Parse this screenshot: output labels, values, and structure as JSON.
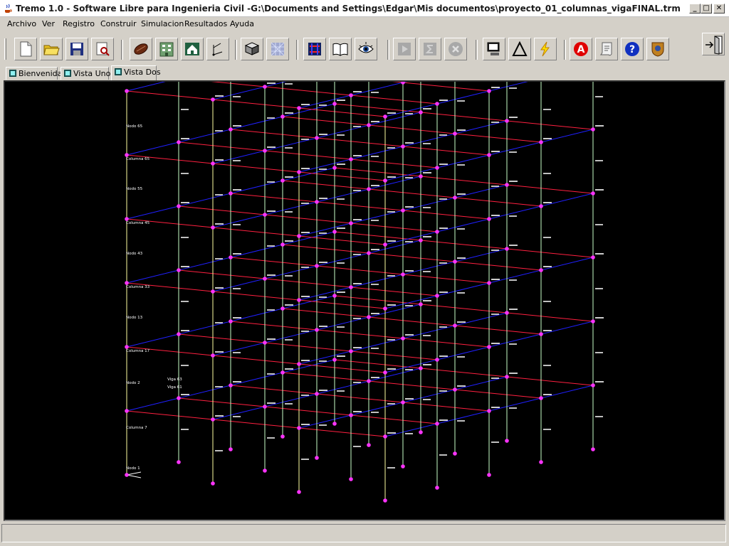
{
  "window": {
    "title": "Tremo 1.0 - Software Libre para Ingenieria Civil -G:\\Documents and Settings\\Edgar\\Mis documentos\\proyecto_01_columnas_vigaFINAL.trm",
    "controls": {
      "minimize": "_",
      "maximize": "□",
      "close": "✕"
    }
  },
  "menu": {
    "items": [
      "Archivo",
      "Ver",
      "Registro",
      "Construir",
      "Simulacion",
      "Resultados",
      "Ayuda"
    ]
  },
  "toolbar": {
    "buttons": [
      {
        "name": "new-file-icon"
      },
      {
        "name": "open-folder-icon"
      },
      {
        "name": "save-icon"
      },
      {
        "name": "print-preview-icon"
      },
      {
        "name": "material-icon"
      },
      {
        "name": "building-icon"
      },
      {
        "name": "house-icon"
      },
      {
        "name": "node-axes-icon"
      },
      {
        "name": "section-icon"
      },
      {
        "name": "mesh-icon"
      },
      {
        "name": "frame-color-icon"
      },
      {
        "name": "book-icon"
      },
      {
        "name": "eye-icon"
      },
      {
        "name": "play-icon"
      },
      {
        "name": "sigma-icon"
      },
      {
        "name": "stop-icon"
      },
      {
        "name": "monitor-icon"
      },
      {
        "name": "delta-icon"
      },
      {
        "name": "lightning-icon"
      },
      {
        "name": "acrobat-icon"
      },
      {
        "name": "script-icon"
      },
      {
        "name": "help-icon"
      },
      {
        "name": "badge-icon"
      }
    ],
    "exit": {
      "name": "exit-door-icon"
    }
  },
  "tabs": [
    {
      "label": "Bienvenida",
      "active": false
    },
    {
      "label": "Vista Uno",
      "active": false
    },
    {
      "label": "Vista Dos",
      "active": true
    }
  ],
  "viewport": {
    "background": "#000000",
    "colors": {
      "node": "#ff33ff",
      "column": "#c8ffc8",
      "column_front": "#ffffa0",
      "beam_x": "#ff2040",
      "beam_y": "#2020ff",
      "label": "#ffffff"
    },
    "labels": {
      "node_1": "Nodo 1",
      "node_2": "Nodo 2",
      "node_13": "Nodo 13",
      "node_43": "Nodo 43",
      "node_55": "Nodo 55",
      "node_65": "Nodo 65",
      "col_7": "Columna 7",
      "col_17": "Columna 17",
      "col_33": "Columna 33",
      "col_45": "Columna 45",
      "col_65": "Columna 65",
      "viga_63": "Viga 63",
      "viga_61": "Viga 61"
    }
  }
}
